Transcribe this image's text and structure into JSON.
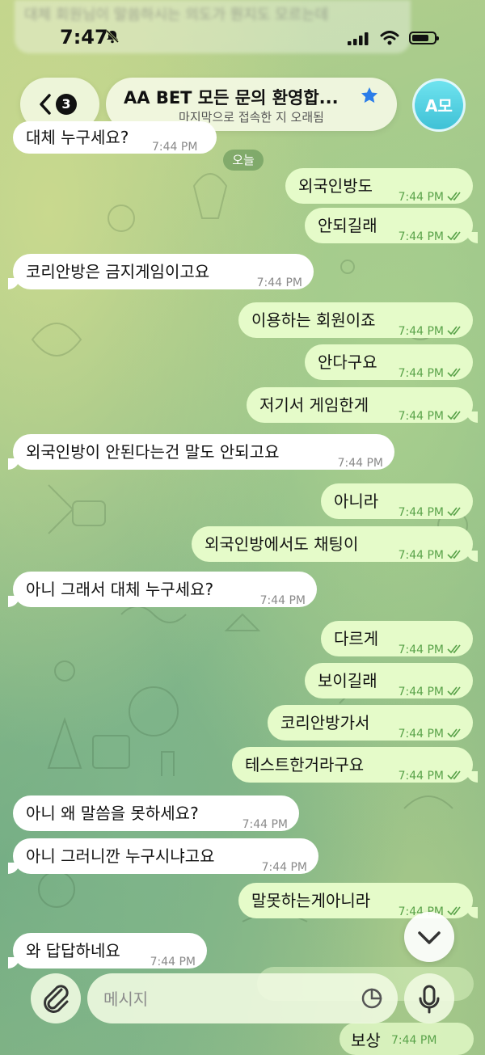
{
  "status_bar": {
    "time": "7:47"
  },
  "ghost_top_text": "대체 회원님이 말씀하시는 의도가 뭔지도 모르는데",
  "header": {
    "back_badge": "3",
    "title": "AA BET 모든 문의 환영합...",
    "subtitle": "마지막으로 접속한 지 오래됨",
    "avatar_initials": "A모"
  },
  "top_partial_message": {
    "text": "대체 누구세요?",
    "time": "7:44 PM"
  },
  "date_chip": "오늘",
  "messages": [
    {
      "dir": "out",
      "text": "외국인방도",
      "time": "7:44 PM"
    },
    {
      "dir": "out",
      "text": "안되길래",
      "time": "7:44 PM"
    },
    {
      "dir": "in",
      "text": "코리안방은 금지게임이고요",
      "time": "7:44 PM"
    },
    {
      "dir": "out",
      "text": "이용하는 회원이죠",
      "time": "7:44 PM"
    },
    {
      "dir": "out",
      "text": "안다구요",
      "time": "7:44 PM"
    },
    {
      "dir": "out",
      "text": "저기서 게임한게",
      "time": "7:44 PM"
    },
    {
      "dir": "in",
      "text": "외국인방이 안된다는건 말도 안되고요",
      "time": "7:44 PM"
    },
    {
      "dir": "out",
      "text": "아니라",
      "time": "7:44 PM"
    },
    {
      "dir": "out",
      "text": "외국인방에서도 채팅이",
      "time": "7:44 PM"
    },
    {
      "dir": "in",
      "text": "아니 그래서 대체 누구세요?",
      "time": "7:44 PM"
    },
    {
      "dir": "out",
      "text": "다르게",
      "time": "7:44 PM"
    },
    {
      "dir": "out",
      "text": "보이길래",
      "time": "7:44 PM"
    },
    {
      "dir": "out",
      "text": "코리안방가서",
      "time": "7:44 PM"
    },
    {
      "dir": "out",
      "text": "테스트한거라구요",
      "time": "7:44 PM"
    },
    {
      "dir": "in",
      "text": "아니 왜 말씀을 못하세요?",
      "time": "7:44 PM"
    },
    {
      "dir": "in",
      "text": "아니 그러니깐 누구시냐고요",
      "time": "7:44 PM"
    },
    {
      "dir": "out",
      "text": "말못하는게아니라",
      "time": "7:44 PM"
    },
    {
      "dir": "in",
      "text": "와 답답하네요",
      "time": "7:44 PM"
    }
  ],
  "ghost_bottom": [
    {
      "text": "보상",
      "time": "7:44 PM"
    }
  ],
  "composer": {
    "placeholder": "메시지"
  },
  "colors": {
    "incoming": "#ffffff",
    "outgoing": "#e5fbc9",
    "read_ticks": "#5aa34a",
    "avatar": "#4cc9dc",
    "star": "#2b7de9"
  }
}
